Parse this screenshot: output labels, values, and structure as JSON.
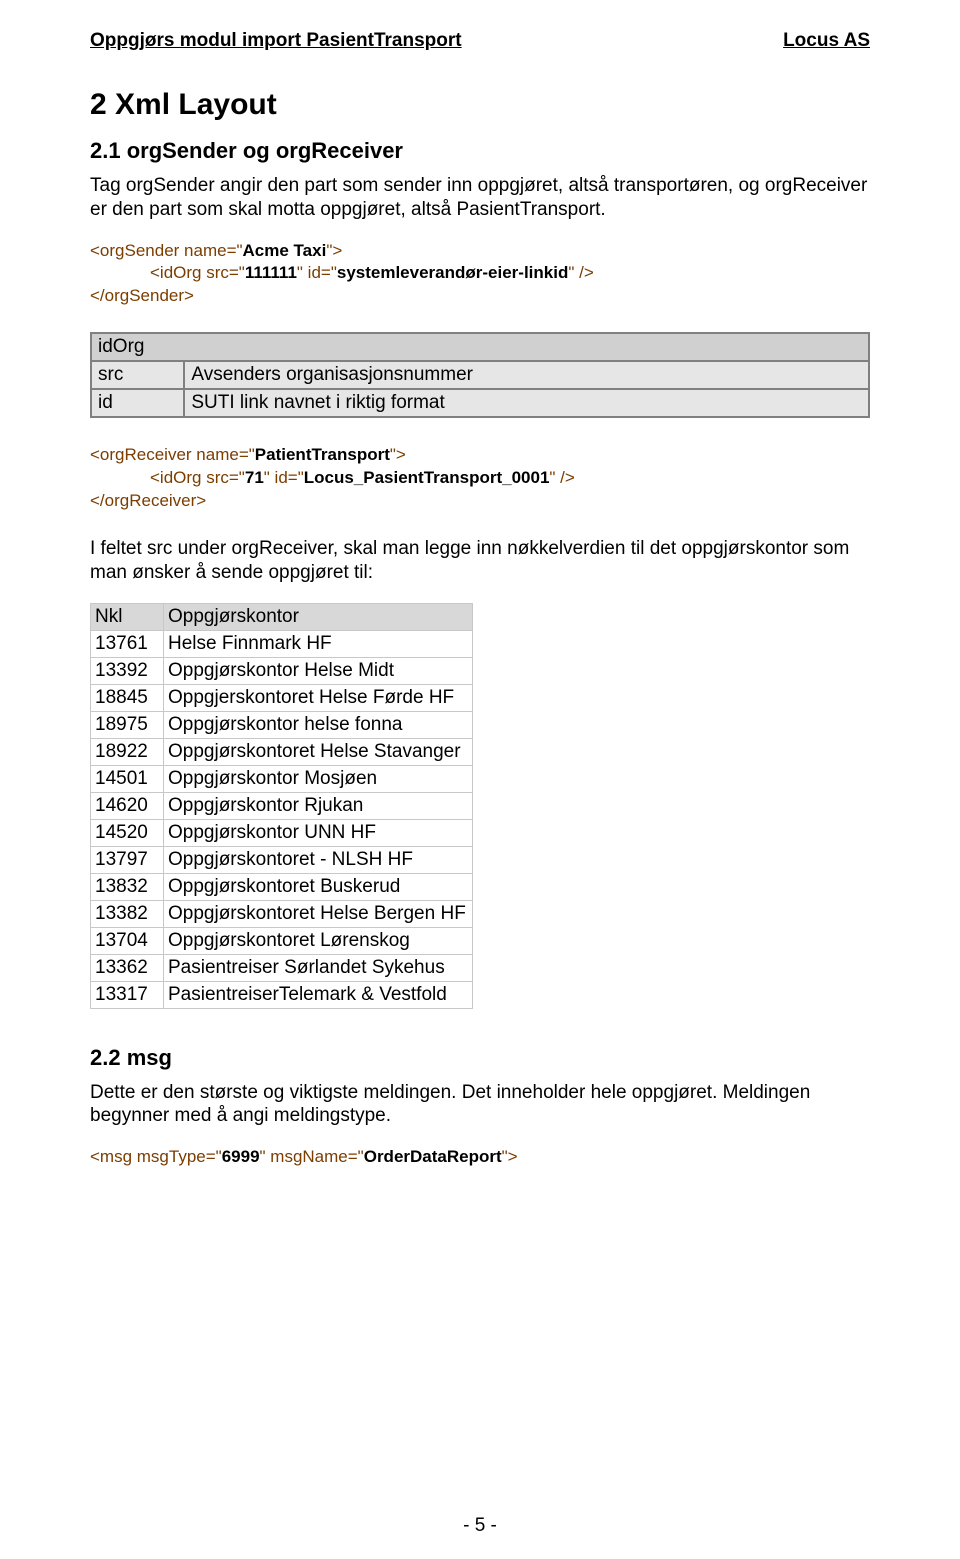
{
  "header": {
    "left": "Oppgjørs modul import PasientTransport",
    "right": "Locus AS"
  },
  "section": {
    "title": "2  Xml Layout",
    "s21_title": "2.1  orgSender og orgReceiver",
    "s21_para": "Tag orgSender angir den part som sender inn oppgjøret, altså transportøren,  og orgReceiver er den part som skal motta oppgjøret, altså PasientTransport.",
    "s22_title": "2.2  msg",
    "s22_para": "Dette er den største og viktigste meldingen. Det inneholder hele oppgjøret. Meldingen begynner med å angi meldingstype."
  },
  "xml1": {
    "l1_a": "<orgSender name=\"",
    "l1_b": "Acme Taxi",
    "l1_c": "\">",
    "l2_a": "<idOrg src=\"",
    "l2_b": "111111",
    "l2_c": "\" id=\"",
    "l2_d": "systemleverandør-eier-linkid",
    "l2_e": "\" />",
    "l3": "</orgSender>"
  },
  "paramTable": {
    "r0": "idOrg",
    "r1k": "src",
    "r1v": "Avsenders organisasjonsnummer",
    "r2k": "id",
    "r2v": "SUTI link navnet i riktig format"
  },
  "xml2": {
    "l1_a": "<orgReceiver name=\"",
    "l1_b": "PatientTransport",
    "l1_c": "\">",
    "l2_a": "<idOrg src=\"",
    "l2_b": "71",
    "l2_c": "\" id=\"",
    "l2_d": "Locus_PasientTransport_0001",
    "l2_e": "\" />",
    "l3": "</orgReceiver>"
  },
  "mid_para": "I feltet src under orgReceiver, skal man legge inn nøkkelverdien til det oppgjørskontor som man ønsker å sende oppgjøret til:",
  "nkl": {
    "h1": "Nkl",
    "h2": "Oppgjørskontor",
    "rows": [
      {
        "k": "13761",
        "v": "Helse Finnmark HF"
      },
      {
        "k": "13392",
        "v": "Oppgjørskontor Helse Midt"
      },
      {
        "k": "18845",
        "v": "Oppgjerskontoret Helse Førde HF"
      },
      {
        "k": "18975",
        "v": "Oppgjørskontor helse fonna"
      },
      {
        "k": "18922",
        "v": "Oppgjørskontoret Helse Stavanger"
      },
      {
        "k": "14501",
        "v": "Oppgjørskontor Mosjøen"
      },
      {
        "k": "14620",
        "v": "Oppgjørskontor Rjukan"
      },
      {
        "k": "14520",
        "v": "Oppgjørskontor UNN HF"
      },
      {
        "k": "13797",
        "v": "Oppgjørskontoret - NLSH HF"
      },
      {
        "k": "13832",
        "v": "Oppgjørskontoret Buskerud"
      },
      {
        "k": "13382",
        "v": "Oppgjørskontoret Helse Bergen HF"
      },
      {
        "k": "13704",
        "v": "Oppgjørskontoret Lørenskog"
      },
      {
        "k": "13362",
        "v": "Pasientreiser Sørlandet Sykehus"
      },
      {
        "k": "13317",
        "v": "PasientreiserTelemark & Vestfold"
      }
    ]
  },
  "xml3": {
    "a": "<msg msgType=\"",
    "b": "6999",
    "c": "\" msgName=\"",
    "d": "OrderDataReport",
    "e": "\">"
  },
  "footer": "- 5 -"
}
